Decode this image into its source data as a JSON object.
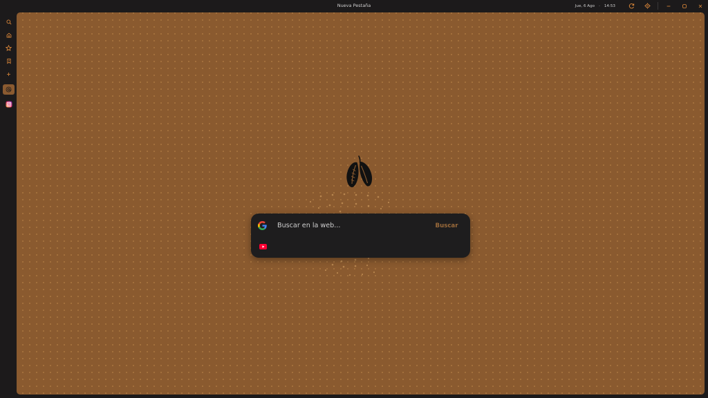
{
  "window": {
    "title": "Nueva Pestaña"
  },
  "system": {
    "date": "Jue, 6 Ago",
    "time": "14:53"
  },
  "controls": {
    "icons": [
      "refresh-icon",
      "settings-icon",
      "minimize-icon",
      "maximize-icon",
      "close-icon"
    ]
  },
  "sidebar": {
    "items": [
      {
        "name": "search",
        "icon": "search-icon"
      },
      {
        "name": "home",
        "icon": "home-icon"
      },
      {
        "name": "favorites",
        "icon": "star-icon"
      },
      {
        "name": "bookmarks",
        "icon": "bookmark-icon"
      },
      {
        "name": "add",
        "icon": "plus-icon"
      },
      {
        "name": "threads",
        "icon": "at-sign-icon",
        "active": true
      },
      {
        "name": "instagram",
        "icon": "instagram-icon"
      }
    ]
  },
  "search": {
    "engine_icon": "google-icon",
    "placeholder": "Buscar en la web...",
    "button_label": "Buscar",
    "shortcuts": [
      {
        "name": "youtube",
        "icon": "youtube-icon"
      }
    ]
  },
  "logo": {
    "icon": "cacao-pod-icon"
  },
  "colors": {
    "background": "#8a5a2f",
    "dot": "#c48c4e",
    "accent": "#9a6a3a",
    "chrome": "#1c1a1b",
    "card": "#1e1d1e",
    "titlebar_icon": "#e08a3a"
  }
}
